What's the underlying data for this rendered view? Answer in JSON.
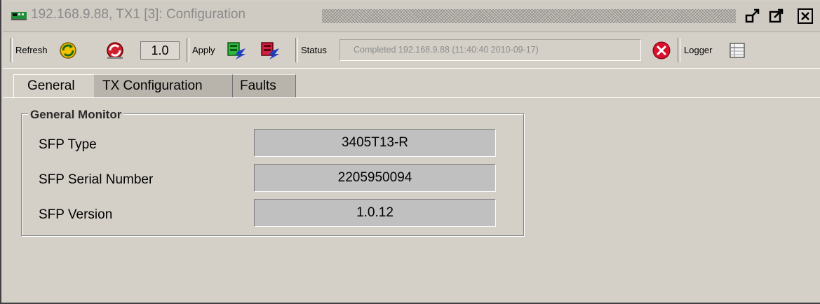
{
  "window": {
    "title": "192.168.9.88, TX1  [3]: Configuration",
    "icons": {
      "app": "network-card-icon",
      "restore": "restore-icon",
      "maximize": "maximize-icon",
      "close": "close-icon"
    }
  },
  "toolbar": {
    "refresh_label": "Refresh",
    "refresh_value": "1.0",
    "apply_label": "Apply",
    "status_label": "Status",
    "status_text": "Completed 192.168.9.88 (11:40:40  2010-09-17)",
    "logger_label": "Logger",
    "icons": {
      "refresh_auto": "refresh-auto-icon",
      "refresh_stop": "refresh-stop-icon",
      "apply_green": "apply-green-icon",
      "apply_red": "apply-red-icon",
      "status_error": "error-icon",
      "logger": "logger-icon"
    }
  },
  "tabs": [
    {
      "label": "General",
      "active": true
    },
    {
      "label": "TX Configuration",
      "active": false
    },
    {
      "label": "Faults",
      "active": false
    }
  ],
  "general_monitor": {
    "title": "General Monitor",
    "fields": [
      {
        "label": "SFP Type",
        "value": "3405T13-R"
      },
      {
        "label": "SFP Serial Number",
        "value": "2205950094"
      },
      {
        "label": "SFP Version",
        "value": "1.0.12"
      }
    ]
  },
  "colors": {
    "background": "#d4d0c8",
    "field_bg": "#c0c0c0",
    "error_red": "#d8102c",
    "chip_green": "#1f8f3a"
  }
}
